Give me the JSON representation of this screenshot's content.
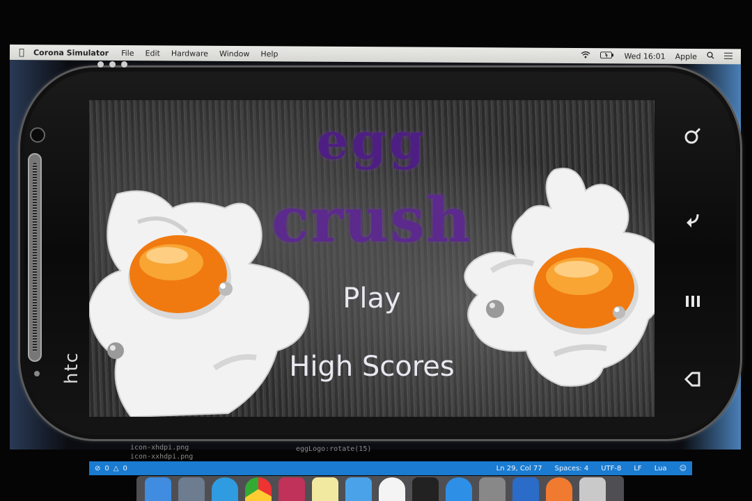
{
  "menubar": {
    "app_name": "Corona Simulator",
    "items": [
      "File",
      "Edit",
      "Hardware",
      "Window",
      "Help"
    ],
    "clock": "Wed 16:01",
    "user": "Apple"
  },
  "device": {
    "brand": "htc"
  },
  "game": {
    "title_line1": "egg",
    "title_line2": "crush",
    "play_label": "Play",
    "high_scores_label": "High Scores",
    "title_color": "#5b2a8c",
    "button_text_color": "#e8e8f0"
  },
  "editor": {
    "file1": "icon-xhdpi.png",
    "file2": "icon-xxhdpi.png",
    "code": "eggLogo:rotate(15)"
  },
  "statusbar": {
    "problems": "0",
    "warnings": "0",
    "position": "Ln 29, Col 77",
    "spaces": "Spaces: 4",
    "encoding": "UTF-8",
    "eol": "LF",
    "language": "Lua"
  },
  "icons": {
    "apple": "apple-icon",
    "wifi": "wifi-icon",
    "battery": "battery-icon",
    "search": "search-icon",
    "list": "list-icon",
    "nav_search": "search-icon",
    "nav_back": "back-icon",
    "nav_menu": "menu-icon",
    "nav_home": "home-icon"
  },
  "colors": {
    "statusbar": "#1a7bd0",
    "yolk": "#f07a10"
  }
}
